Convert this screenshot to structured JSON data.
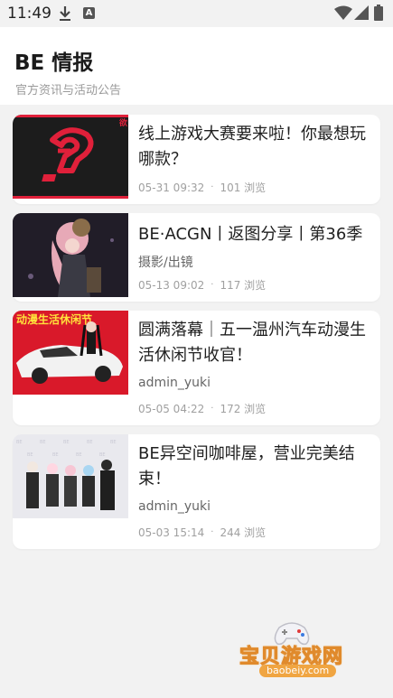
{
  "status": {
    "time": "11:49",
    "a_badge": "A"
  },
  "header": {
    "title": "BE 情报",
    "subtitle": "官方资讯与活动公告"
  },
  "articles": [
    {
      "title": "线上游戏大赛要来啦！你最想玩哪款？",
      "author": "",
      "date": "05-31 09:32",
      "views": "101 浏览",
      "thumb_logo": "?"
    },
    {
      "title": "BE·ACGN丨返图分享丨第36季",
      "author": "摄影/出镜",
      "date": "05-13 09:02",
      "views": "117 浏览"
    },
    {
      "title": "圆满落幕｜五一温州汽车动漫生活休闲节收官！",
      "author": "admin_yuki",
      "date": "05-05 04:22",
      "views": "172 浏览",
      "thumb_banner": "动漫生活休闲节"
    },
    {
      "title": "BE异空间咖啡屋，营业完美结束！",
      "author": "admin_yuki",
      "date": "05-03 15:14",
      "views": "244 浏览"
    }
  ],
  "watermark": {
    "text": "宝贝游戏网",
    "url": "baobeiy.com"
  },
  "colors": {
    "accent_red": "#e0203a",
    "background": "#f2f2f2",
    "card": "#ffffff",
    "watermark_orange": "#f0a542"
  }
}
